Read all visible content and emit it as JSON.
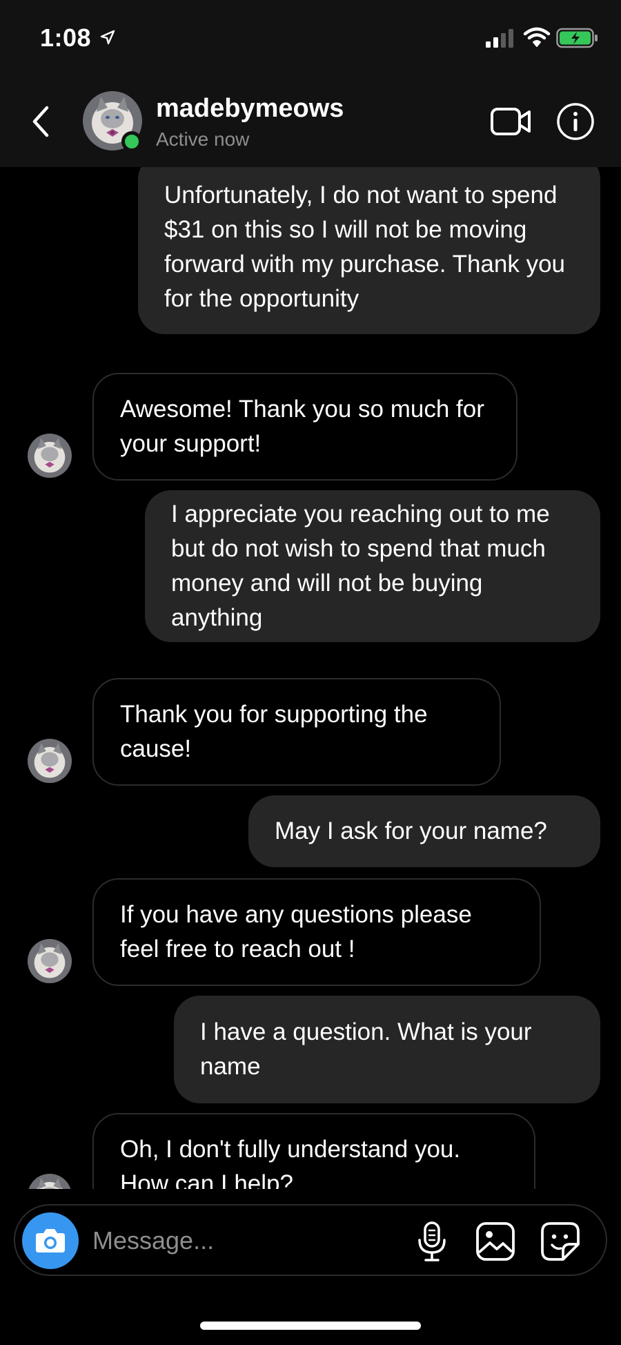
{
  "status_bar": {
    "time": "1:08"
  },
  "header": {
    "username": "madebymeows",
    "presence": "Active now",
    "back_icon": "chevron-left-icon",
    "video_icon": "video-camera-icon",
    "info_icon": "info-icon"
  },
  "thread": {
    "messages": [
      {
        "sender": "me",
        "text": "Unfortunately, I do not want to spend $31 on this so I will not be moving forward with my purchase. Thank you for the opportunity"
      },
      {
        "sender": "them",
        "text": "Awesome! Thank you so much for your support!"
      },
      {
        "sender": "me",
        "text": "I appreciate you reaching out to me but do not wish to spend that much money and will not be buying anything"
      },
      {
        "sender": "them",
        "text": "Thank you for supporting the cause!"
      },
      {
        "sender": "me",
        "text": "May I ask for your name?"
      },
      {
        "sender": "them",
        "text": "If you have any questions please feel free to reach out !"
      },
      {
        "sender": "me",
        "text": "I have a question. What is your name"
      },
      {
        "sender": "them",
        "text": "Oh, I don't fully understand you. How can I help?"
      }
    ]
  },
  "composer": {
    "placeholder": "Message...",
    "camera_icon": "camera-icon",
    "mic_icon": "microphone-icon",
    "gallery_icon": "gallery-icon",
    "sticker_icon": "sticker-icon"
  },
  "colors": {
    "background": "#000000",
    "header": "#121212",
    "my_bubble": "#262626",
    "their_bubble_border": "#2c2c2c",
    "accent_blue": "#3797f0",
    "online_green": "#35c759",
    "secondary_text": "#8e8e8e"
  }
}
